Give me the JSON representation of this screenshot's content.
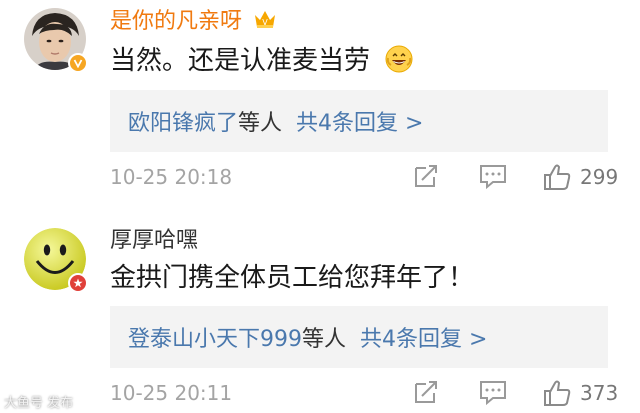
{
  "comments": [
    {
      "username": "是你的凡亲呀",
      "content": "当然。还是认准麦当劳",
      "replies": {
        "names": "欧阳锋疯了",
        "suffix": "等人",
        "total": "共4条回复 >"
      },
      "time": "10-25 20:18",
      "likes": "299"
    },
    {
      "username": "厚厚哈嘿",
      "content": "金拱门携全体员工给您拜年了！",
      "replies": {
        "names": "登泰山小天下999",
        "suffix": "等人",
        "total": "共4条回复 >"
      },
      "time": "10-25 20:11",
      "likes": "373"
    }
  ],
  "colors": {
    "vip_name": "#f07a10",
    "link": "#4a78ad",
    "meta": "#a4a4a4",
    "reply_bg": "#f3f3f3"
  },
  "icons": [
    "crown-vip-icon",
    "grinning-emoji-icon",
    "verified-badge-icon",
    "share-icon",
    "comment-icon",
    "thumbs-up-icon"
  ],
  "watermark": "大鱼号 发布"
}
